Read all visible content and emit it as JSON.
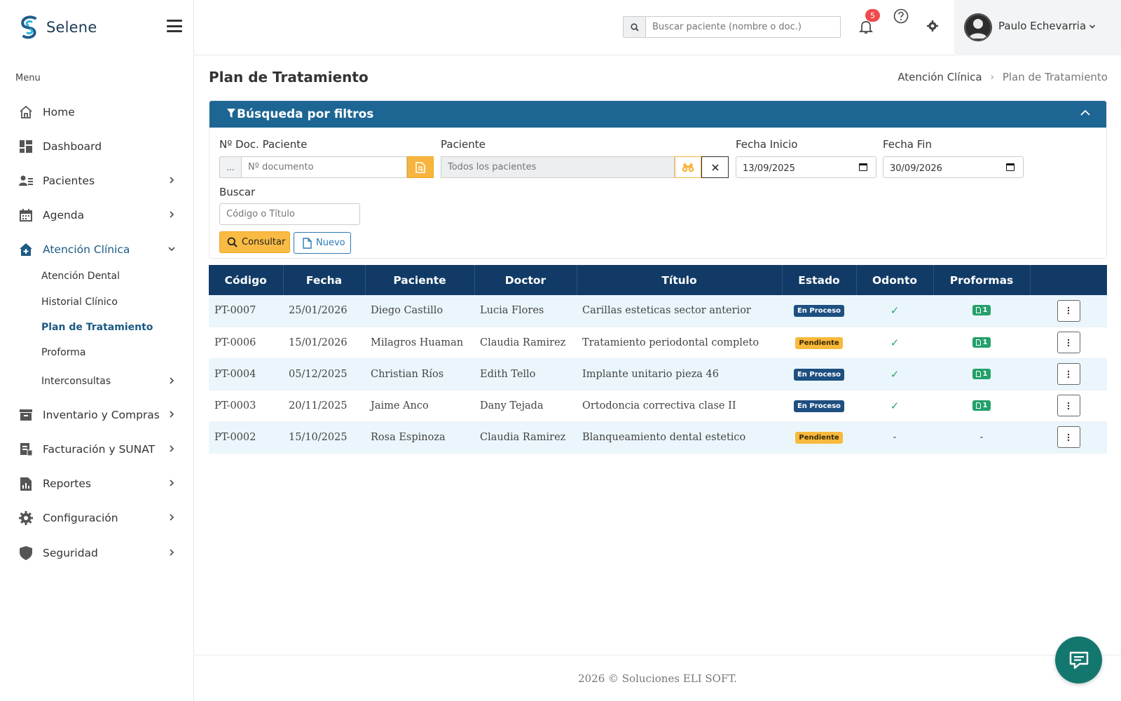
{
  "app": {
    "name": "Selene"
  },
  "sidebar": {
    "menu_label": "Menu",
    "items": [
      {
        "label": "Home",
        "icon": "home-icon"
      },
      {
        "label": "Dashboard",
        "icon": "dashboard-icon"
      },
      {
        "label": "Pacientes",
        "icon": "patients-icon"
      },
      {
        "label": "Agenda",
        "icon": "calendar-icon"
      },
      {
        "label": "Atención Clínica",
        "icon": "clinic-icon"
      },
      {
        "label": "Inventario y Compras",
        "icon": "inventory-icon"
      },
      {
        "label": "Facturación y SUNAT",
        "icon": "billing-icon"
      },
      {
        "label": "Reportes",
        "icon": "reports-icon"
      },
      {
        "label": "Configuración",
        "icon": "gear-icon"
      },
      {
        "label": "Seguridad",
        "icon": "shield-icon"
      }
    ],
    "sub_items": [
      {
        "label": "Atención Dental"
      },
      {
        "label": "Historial Clínico"
      },
      {
        "label": "Plan de Tratamiento"
      },
      {
        "label": "Proforma"
      },
      {
        "label": "Interconsultas"
      }
    ]
  },
  "topbar": {
    "search_placeholder": "Buscar paciente (nombre o doc.)",
    "notifications_count": "5",
    "user_name": "Paulo Echevarria"
  },
  "page": {
    "title": "Plan de Tratamiento",
    "breadcrumb": [
      "Atención Clínica",
      "Plan de Tratamiento"
    ]
  },
  "filters": {
    "title": "Búsqueda por filtros",
    "doc_label": "Nº Doc. Paciente",
    "doc_dots": "...",
    "doc_placeholder": "Nº documento",
    "patient_label": "Paciente",
    "patient_placeholder": "Todos los pacientes",
    "start_label": "Fecha Inicio",
    "start_value": "13/09/2025",
    "end_label": "Fecha Fin",
    "end_value": "30/09/2026",
    "search_label": "Buscar",
    "search_placeholder": "Código o Título",
    "consultar_label": "Consultar",
    "nuevo_label": "Nuevo"
  },
  "table": {
    "headers": [
      "Código",
      "Fecha",
      "Paciente",
      "Doctor",
      "Título",
      "Estado",
      "Odonto",
      "Proformas",
      ""
    ],
    "rows": [
      {
        "codigo": "PT-0007",
        "fecha": "25/01/2026",
        "paciente": "Diego Castillo",
        "doctor": "Lucia Flores",
        "titulo": "Carillas esteticas sector anterior",
        "estado": "En Proceso",
        "odonto": "✓",
        "proformas": "1"
      },
      {
        "codigo": "PT-0006",
        "fecha": "15/01/2026",
        "paciente": "Milagros Huaman",
        "doctor": "Claudia Ramirez",
        "titulo": "Tratamiento periodontal completo",
        "estado": "Pendiente",
        "odonto": "✓",
        "proformas": "1"
      },
      {
        "codigo": "PT-0004",
        "fecha": "05/12/2025",
        "paciente": "Christian Ríos",
        "doctor": "Edith Tello",
        "titulo": "Implante unitario pieza 46",
        "estado": "En Proceso",
        "odonto": "✓",
        "proformas": "1"
      },
      {
        "codigo": "PT-0003",
        "fecha": "20/11/2025",
        "paciente": "Jaime Anco",
        "doctor": "Dany Tejada",
        "titulo": "Ortodoncia correctiva clase II",
        "estado": "En Proceso",
        "odonto": "✓",
        "proformas": "1"
      },
      {
        "codigo": "PT-0002",
        "fecha": "15/10/2025",
        "paciente": "Rosa Espinoza",
        "doctor": "Claudia Ramirez",
        "titulo": "Blanqueamiento dental estetico",
        "estado": "Pendiente",
        "odonto": "-",
        "proformas": "-"
      }
    ]
  },
  "footer": {
    "text": "2026 © Soluciones ELI SOFT."
  },
  "colors": {
    "primary": "#1d6693",
    "table_header": "#113b66",
    "accent": "#f9bb43",
    "success": "#24a06a",
    "danger": "#ef4b4b"
  }
}
